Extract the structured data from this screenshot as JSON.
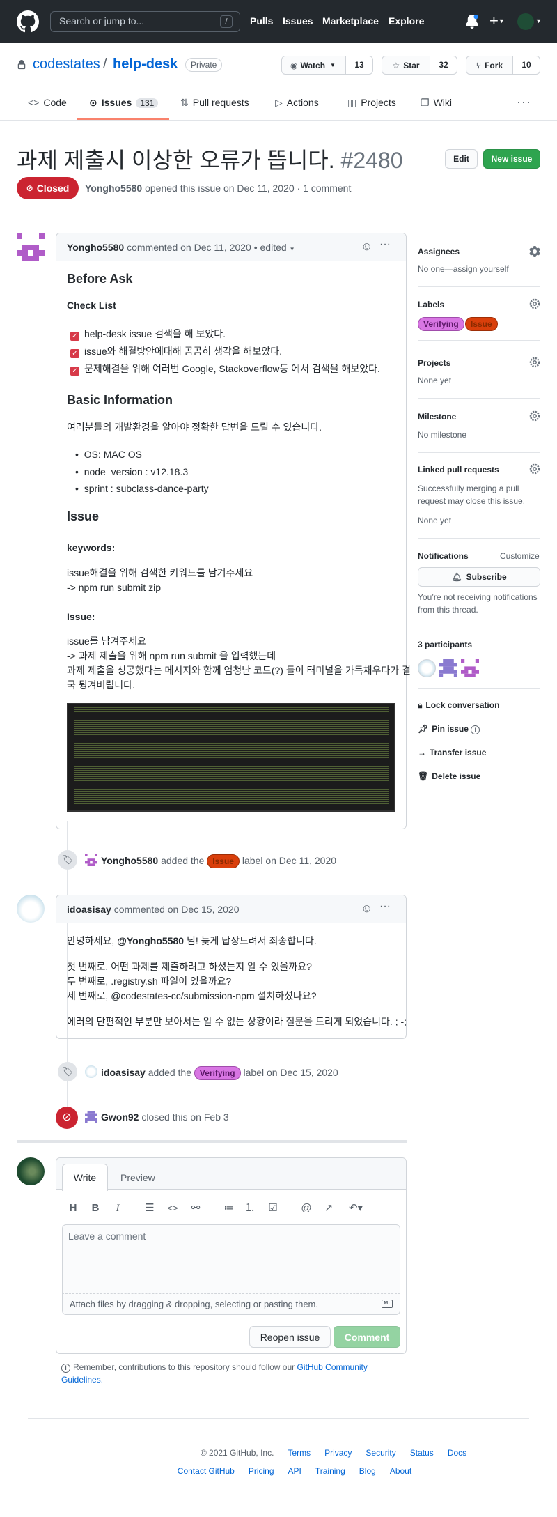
{
  "header": {
    "search_placeholder": "Search or jump to...",
    "slash_key": "/",
    "nav": [
      "Pulls",
      "Issues",
      "Marketplace",
      "Explore"
    ]
  },
  "repo": {
    "owner": "codestates",
    "separator": "/",
    "name": "help-desk",
    "visibility": "Private",
    "watch_label": "Watch",
    "watch_count": "13",
    "star_label": "Star",
    "star_count": "32",
    "fork_label": "Fork",
    "fork_count": "10"
  },
  "tabs": {
    "code": "Code",
    "issues": "Issues",
    "issues_count": "131",
    "pulls": "Pull requests",
    "actions": "Actions",
    "projects": "Projects",
    "wiki": "Wiki"
  },
  "issue": {
    "title": "과제 제출시 이상한 오류가 뜹니다.",
    "number": "#2480",
    "edit_label": "Edit",
    "new_issue_label": "New issue",
    "state": "Closed",
    "author": "Yongho5580",
    "meta": "opened this issue on Dec 11, 2020 · 1 comment"
  },
  "comment1": {
    "author": "Yongho5580",
    "meta": "commented on Dec 11, 2020 • edited",
    "h_before": "Before Ask",
    "h_checklist": "Check List",
    "checks": [
      "help-desk issue 검색을 해 보았다.",
      "issue와 해결방안에대해 곰곰히 생각을 해보았다.",
      "문제해결을 위해 여러번 Google, Stackoverflow등 에서 검색을 해보았다."
    ],
    "h_basic": "Basic Information",
    "basic_intro": "여러분들의 개발환경을 알아야 정확한 답변을 드릴 수 있습니다.",
    "env": [
      "OS: MAC OS",
      "node_version : v12.18.3",
      "sprint : subclass-dance-party"
    ],
    "h_issue": "Issue",
    "h_keywords": "keywords:",
    "kw1": "issue해결을 위해 검색한 키워드를 남겨주세요",
    "kw2": "-> npm run submit zip",
    "h_issue2": "Issue:",
    "is1": "issue를 남겨주세요",
    "is2": "-> 과제 제출을 위해 npm run submit 을 입력했는데",
    "is3": "과제 제출을 성공했다는 메시지와 함께 엄청난 코드(?) 들이 터미널을 가득채우다가 결",
    "is4": "국 뒹겨버립니다."
  },
  "event1": {
    "actor": "Yongho5580",
    "pre": "added the",
    "label": "Issue",
    "post": "label on Dec 11, 2020"
  },
  "comment2": {
    "author": "idoasisay",
    "meta": "commented on Dec 15, 2020",
    "l1a": "안녕하세요,",
    "l1b": "@Yongho5580",
    "l1c": "님! 늦게 답장드려서 죄송합니다.",
    "l2": "첫 번째로, 어떤 과제를 제출하려고 하셨는지 알 수 있을까요?",
    "l3": "두 번째로, .registry.sh 파일이 있을까요?",
    "l4": "세 번째로, @codestates-cc/submission-npm 설치하셨나요?",
    "l5": "에러의 단편적인 부분만 보아서는 알 수 없는 상황이라 질문을 드리게 되었습니다. ; -;"
  },
  "event2": {
    "actor": "idoasisay",
    "pre": "added the",
    "label": "Verifying",
    "post": "label on Dec 15, 2020"
  },
  "event3": {
    "actor": "Gwon92",
    "text": "closed this on Feb 3"
  },
  "composer": {
    "tab_write": "Write",
    "tab_preview": "Preview",
    "placeholder": "Leave a comment",
    "attach": "Attach files by dragging & dropping, selecting or pasting them.",
    "reopen": "Reopen issue",
    "comment": "Comment",
    "note": "Remember, contributions to this repository should follow our",
    "note_link1": "GitHub Community",
    "note_link2": "Guidelines."
  },
  "sidebar": {
    "assignees": "Assignees",
    "assignees_text": "No one—assign yourself",
    "labels": "Labels",
    "label_verifying": "Verifying",
    "label_issue": "Issue",
    "projects": "Projects",
    "projects_text": "None yet",
    "milestone": "Milestone",
    "milestone_text": "No milestone",
    "linked": "Linked pull requests",
    "linked_text1": "Successfully merging a pull",
    "linked_text2": "request may close this issue.",
    "linked_none": "None yet",
    "notifications": "Notifications",
    "customize": "Customize",
    "subscribe": "Subscribe",
    "notif_text1": "You’re not receiving notifications",
    "notif_text2": "from this thread.",
    "participants": "3 participants",
    "lock": "Lock conversation",
    "pin": "Pin issue",
    "transfer": "Transfer issue",
    "delete": "Delete issue"
  },
  "footer": {
    "copyright": "© 2021 GitHub, Inc.",
    "row1": [
      "Terms",
      "Privacy",
      "Security",
      "Status",
      "Docs"
    ],
    "row2": [
      "Contact GitHub",
      "Pricing",
      "API",
      "Training",
      "Blog",
      "About"
    ]
  },
  "colors": {
    "header": "#24292e",
    "closed": "#cb2431",
    "green": "#2ea44f",
    "verifying": "#d876e3",
    "issue_label": "#d93f0b"
  }
}
